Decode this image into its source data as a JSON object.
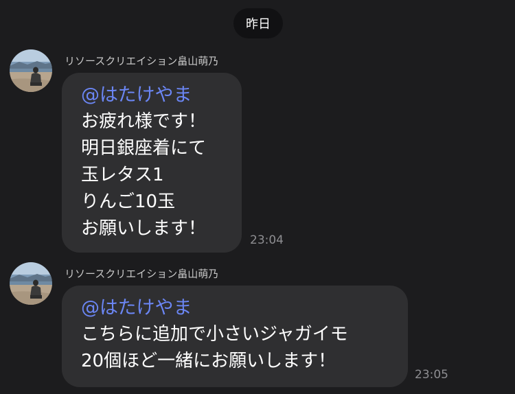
{
  "date_divider": "昨日",
  "messages": [
    {
      "sender": "リソースクリエイション畠山萌乃",
      "mention": "@はたけやま",
      "lines": [
        "お疲れ様です！",
        "明日銀座着にて",
        "玉レタス1",
        "りんご10玉",
        "お願いします！"
      ],
      "time": "23:04",
      "avatar_icon": "profile-photo-beach"
    },
    {
      "sender": "リソースクリエイション畠山萌乃",
      "mention": "@はたけやま",
      "lines": [
        "こちらに追加で小さいジャガイモ",
        "20個ほど一緒にお願いします！"
      ],
      "time": "23:05",
      "avatar_icon": "profile-photo-beach"
    }
  ],
  "colors": {
    "background": "#1c1c1e",
    "bubble": "#2f2f31",
    "mention": "#6b86f4",
    "timestamp": "#8e8e92",
    "date_pill": "#111113"
  }
}
